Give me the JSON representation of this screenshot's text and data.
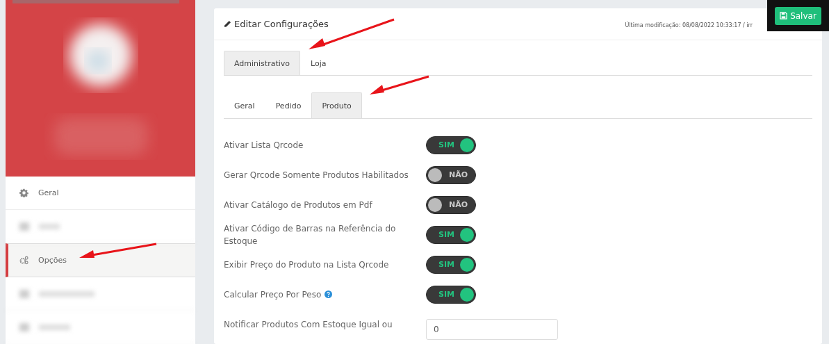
{
  "sidebar": {
    "items": [
      {
        "label": "Geral",
        "selected": false
      },
      {
        "label": "Opções",
        "selected": true
      }
    ]
  },
  "panel": {
    "title": "Editar Configurações",
    "modified": "Última modificação: 08/08/2022 10:33:17 / irr"
  },
  "save_button": "Salvar",
  "tabs": [
    {
      "label": "Administrativo",
      "selected": true
    },
    {
      "label": "Loja",
      "selected": false
    }
  ],
  "subtabs": [
    {
      "label": "Geral",
      "selected": false
    },
    {
      "label": "Pedido",
      "selected": false
    },
    {
      "label": "Produto",
      "selected": true
    }
  ],
  "settings": [
    {
      "kind": "toggle",
      "label": "Ativar Lista Qrcode",
      "on": true,
      "text": "SIM"
    },
    {
      "kind": "toggle",
      "label": "Gerar Qrcode Somente Produtos Habilitados",
      "on": false,
      "text": "NÃO"
    },
    {
      "kind": "toggle",
      "label": "Ativar Catálogo de Produtos em Pdf",
      "on": false,
      "text": "NÃO"
    },
    {
      "kind": "toggle",
      "label": "Ativar Código de Barras na Referência do Estoque",
      "on": true,
      "text": "SIM"
    },
    {
      "kind": "toggle",
      "label": "Exibir Preço do Produto na Lista Qrcode",
      "on": true,
      "text": "SIM"
    },
    {
      "kind": "toggle",
      "label": "Calcular Preço Por Peso",
      "help": true,
      "on": true,
      "text": "SIM"
    },
    {
      "kind": "input",
      "label": "Notificar Produtos Com Estoque Igual ou",
      "value": "0"
    }
  ]
}
